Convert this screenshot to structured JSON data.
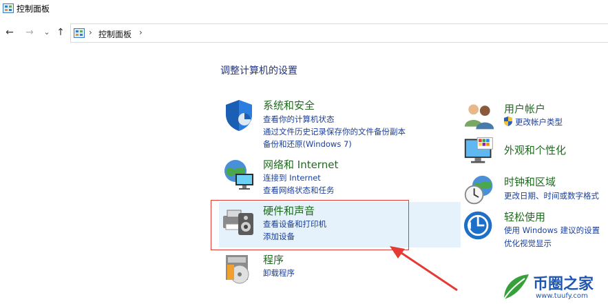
{
  "window": {
    "title": "控制面板"
  },
  "nav": {
    "back_icon": "←",
    "forward_icon": "→",
    "recent_icon": "⌄",
    "up_icon": "↑",
    "separator": "›",
    "breadcrumb": "控制面板",
    "trailing_separator": "›"
  },
  "main": {
    "title": "调整计算机的设置"
  },
  "categories": {
    "system_security": {
      "heading": "系统和安全",
      "links": [
        "查看你的计算机状态",
        "通过文件历史记录保存你的文件备份副本",
        "备份和还原(Windows 7)"
      ]
    },
    "network": {
      "heading": "网络和 Internet",
      "links": [
        "连接到 Internet",
        "查看网络状态和任务"
      ]
    },
    "hardware_sound": {
      "heading": "硬件和声音",
      "links": [
        "查看设备和打印机",
        "添加设备"
      ]
    },
    "programs": {
      "heading": "程序",
      "links": [
        "卸载程序"
      ]
    },
    "user_accounts": {
      "heading": "用户帐户",
      "links": [
        "更改帐户类型"
      ]
    },
    "appearance": {
      "heading": "外观和个性化",
      "links": []
    },
    "clock_region": {
      "heading": "时钟和区域",
      "links": [
        "更改日期、时间或数字格式"
      ]
    },
    "ease_of_access": {
      "heading": "轻松使用",
      "links": [
        "使用 Windows 建议的设置",
        "优化视觉显示"
      ]
    }
  },
  "watermark": {
    "brand": "币圈之家",
    "url": "www.tuufy.com"
  },
  "colors": {
    "heading_green": "#1e6b1e",
    "link_blue": "#1a3f9c",
    "highlight_bg": "#e5f1fb",
    "annotation_red": "#e53935"
  }
}
